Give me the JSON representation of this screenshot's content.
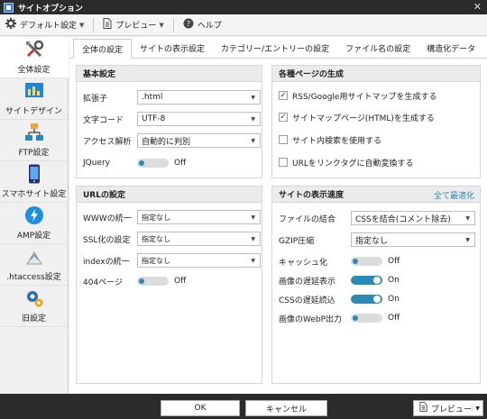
{
  "window": {
    "title": "サイトオプション",
    "close_glyph": "✕"
  },
  "menubar": {
    "default_settings_label": "デフォルト設定",
    "preview_label": "プレビュー",
    "help_label": "ヘルプ"
  },
  "sidebar": {
    "items": [
      {
        "label": "全体設定",
        "icon": "tools-icon"
      },
      {
        "label": "サイトデザイン",
        "icon": "chart-icon"
      },
      {
        "label": "FTP設定",
        "icon": "network-icon"
      },
      {
        "label": "スマホサイト設定",
        "icon": "smartphone-icon"
      },
      {
        "label": "AMP設定",
        "icon": "amp-lightning-icon"
      },
      {
        "label": ".htaccess設定",
        "icon": "file-icon"
      },
      {
        "label": "旧設定",
        "icon": "gears-icon"
      }
    ]
  },
  "tabs": [
    "全体の設定",
    "サイトの表示設定",
    "カテゴリー/エントリーの設定",
    "ファイル名の設定",
    "構造化データ"
  ],
  "basic": {
    "title": "基本設定",
    "ext_label": "拡張子",
    "ext_value": ".html",
    "charset_label": "文字コード",
    "charset_value": "UTF-8",
    "access_label": "アクセス解析",
    "access_value": "自動的に判別",
    "jquery_label": "JQuery",
    "jquery_state": "Off"
  },
  "pages": {
    "title": "各種ページの生成",
    "items": [
      {
        "label": "RSS/Google用サイトマップを生成する",
        "checked": true
      },
      {
        "label": "サイトマップページ(HTML)を生成する",
        "checked": true
      },
      {
        "label": "サイト内検索を使用する",
        "checked": false
      },
      {
        "label": "URLをリンクタグに自動変換する",
        "checked": false
      }
    ],
    "check_glyph": "✓"
  },
  "url": {
    "title": "URLの設定",
    "www_label": "WWWの統一",
    "www_value": "指定なし",
    "ssl_label": "SSL化の設定",
    "ssl_value": "指定なし",
    "index_label": "indexの統一",
    "index_value": "指定なし",
    "p404_label": "404ページ",
    "p404_state": "Off"
  },
  "speed": {
    "title": "サイトの表示速度",
    "optimize_all": "全て最適化",
    "combine_label": "ファイルの結合",
    "combine_value": "CSSを結合(コメント除去)",
    "gzip_label": "GZIP圧縮",
    "gzip_value": "指定なし",
    "cache_label": "キャッシュ化",
    "cache_state": "Off",
    "lazy_img_label": "画像の遅延表示",
    "lazy_img_state": "On",
    "lazy_css_label": "CSSの遅延読込",
    "lazy_css_state": "On",
    "webp_label": "画像のWebP出力",
    "webp_state": "Off"
  },
  "footer": {
    "ok": "OK",
    "cancel": "キャンセル",
    "preview": "プレビュー"
  },
  "colors": {
    "accent": "#2a8ab7",
    "titlebar": "#2b2b2b"
  }
}
